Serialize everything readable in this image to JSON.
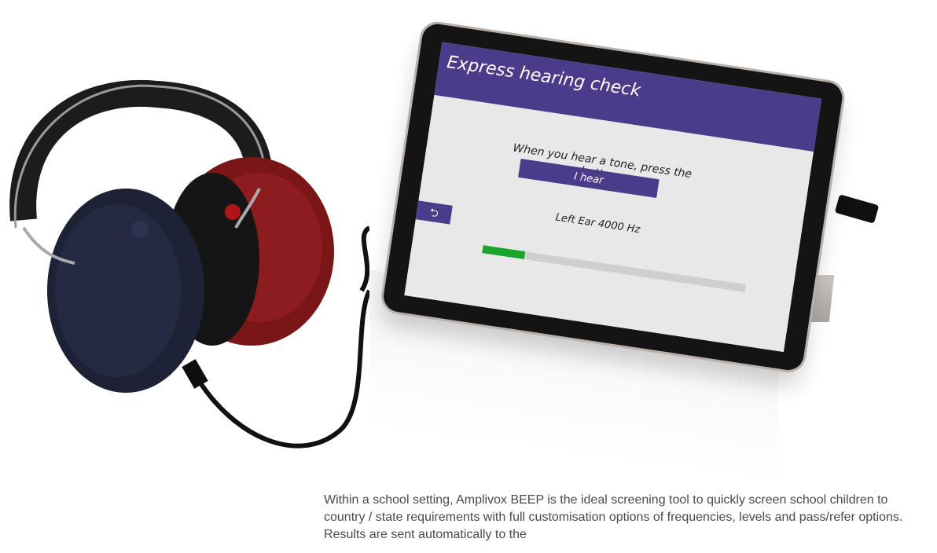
{
  "app": {
    "title": "Express hearing check",
    "instruction": "When you hear a tone, press the button.",
    "i_hear_label": "I hear",
    "status_text": "Left Ear 4000 Hz",
    "back_icon": "back-arrow-icon",
    "progress_fraction": 0.16
  },
  "colors": {
    "header": "#4a3b8b",
    "progress_fill": "#1aa52e",
    "progress_track": "#cfcfcf",
    "screen_bg": "#e8e8e8"
  },
  "caption": {
    "text": "Within a school setting, Amplivox BEEP is the ideal screening tool to quickly screen school children to country / state requirements with full customisation options of frequencies, levels and pass/refer options. Results are sent automatically to the"
  }
}
